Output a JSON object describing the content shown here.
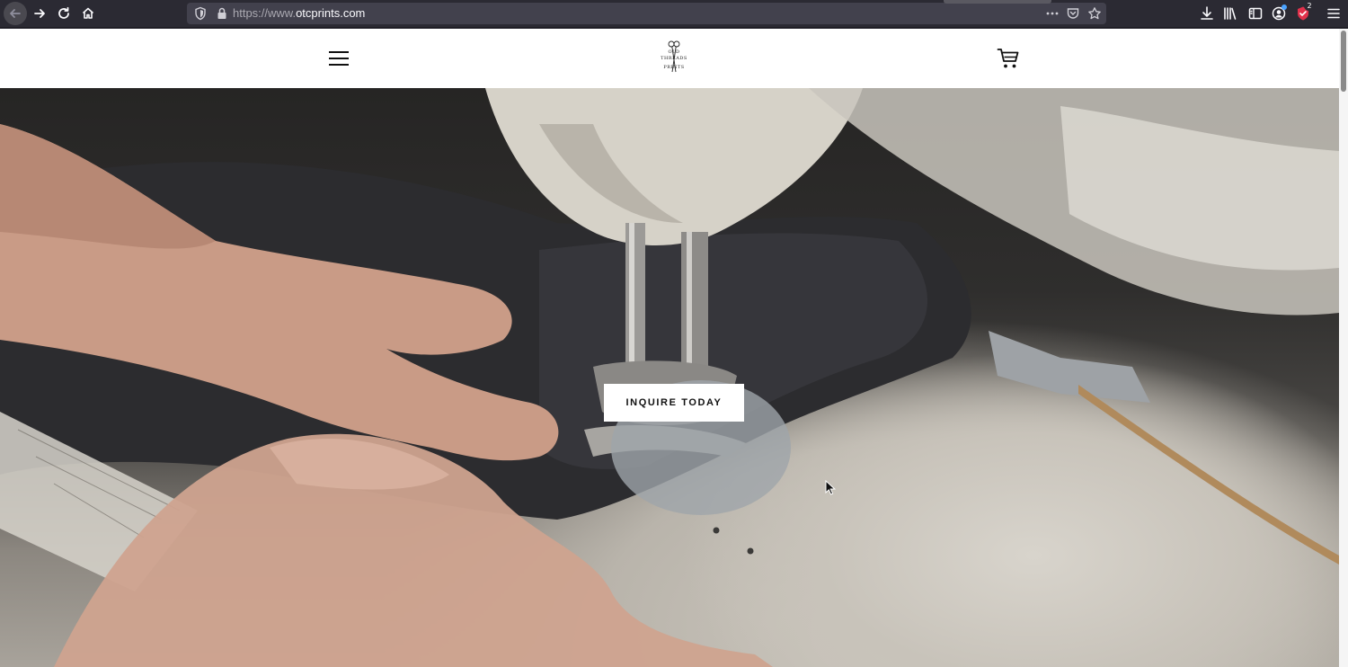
{
  "browser": {
    "url_prefix": "https://www.",
    "url_domain": "otcprints.com",
    "extension_badge": "2",
    "icons": {
      "back": "back-arrow-icon",
      "forward": "forward-arrow-icon",
      "reload": "reload-icon",
      "home": "home-icon",
      "shield": "tracking-shield-icon",
      "lock": "lock-icon",
      "more": "more-dots-icon",
      "pocket": "pocket-icon",
      "bookmark": "star-icon",
      "download": "download-icon",
      "library": "library-icon",
      "sidebar": "sidebar-icon",
      "account": "account-icon",
      "extension": "extension-icon",
      "menu": "hamburger-menu-icon"
    }
  },
  "site": {
    "logo": {
      "line1": "OLD",
      "line2": "THREADS",
      "line3": "PRINTS"
    },
    "header": {
      "menu_icon": "hamburger-icon",
      "cart_icon": "cart-icon"
    },
    "hero": {
      "cta_label": "INQUIRE TODAY"
    }
  },
  "colors": {
    "chrome_bg": "#2b2a33",
    "urlbar_bg": "#42414d",
    "header_bg": "#ffffff",
    "cta_bg": "#ffffff",
    "cta_text": "#111111"
  }
}
